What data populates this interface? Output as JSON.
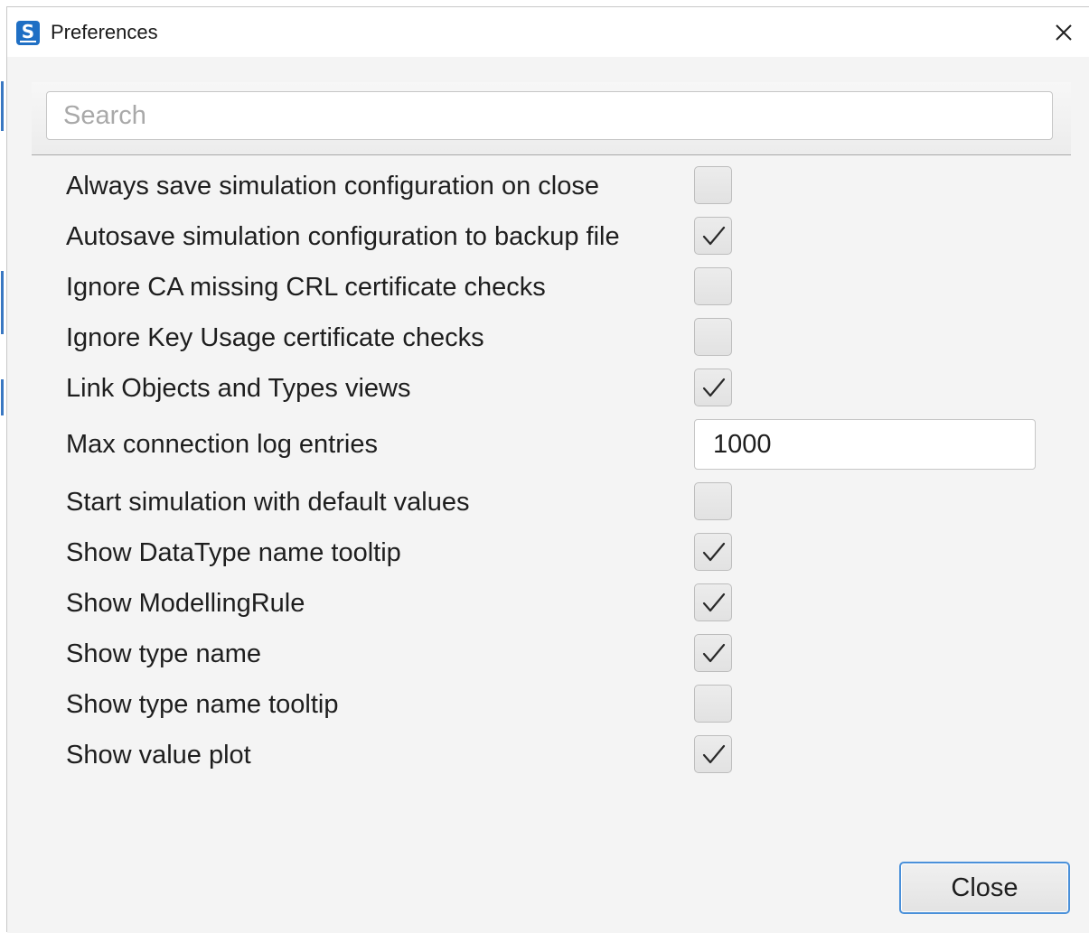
{
  "window": {
    "title": "Preferences",
    "icon_letter": "S"
  },
  "search": {
    "placeholder": "Search",
    "value": ""
  },
  "preferences": [
    {
      "label": "Always save simulation configuration on close",
      "type": "checkbox",
      "checked": false
    },
    {
      "label": "Autosave simulation configuration to backup file",
      "type": "checkbox",
      "checked": true
    },
    {
      "label": "Ignore CA missing CRL certificate checks",
      "type": "checkbox",
      "checked": false
    },
    {
      "label": "Ignore Key Usage certificate checks",
      "type": "checkbox",
      "checked": false
    },
    {
      "label": "Link Objects and Types views",
      "type": "checkbox",
      "checked": true
    },
    {
      "label": "Max connection log entries",
      "type": "number",
      "value": "1000"
    },
    {
      "label": "Start simulation with default values",
      "type": "checkbox",
      "checked": false
    },
    {
      "label": "Show DataType name tooltip",
      "type": "checkbox",
      "checked": true
    },
    {
      "label": "Show ModellingRule",
      "type": "checkbox",
      "checked": true
    },
    {
      "label": "Show type name",
      "type": "checkbox",
      "checked": true
    },
    {
      "label": "Show type name tooltip",
      "type": "checkbox",
      "checked": false
    },
    {
      "label": "Show value plot",
      "type": "checkbox",
      "checked": true
    }
  ],
  "footer": {
    "close_label": "Close"
  },
  "icons": {
    "app": "app-logo-icon",
    "close": "close-icon",
    "check": "checkmark-icon"
  },
  "colors": {
    "accent": "#4a90d9",
    "app_icon": "#1f6fc4"
  }
}
